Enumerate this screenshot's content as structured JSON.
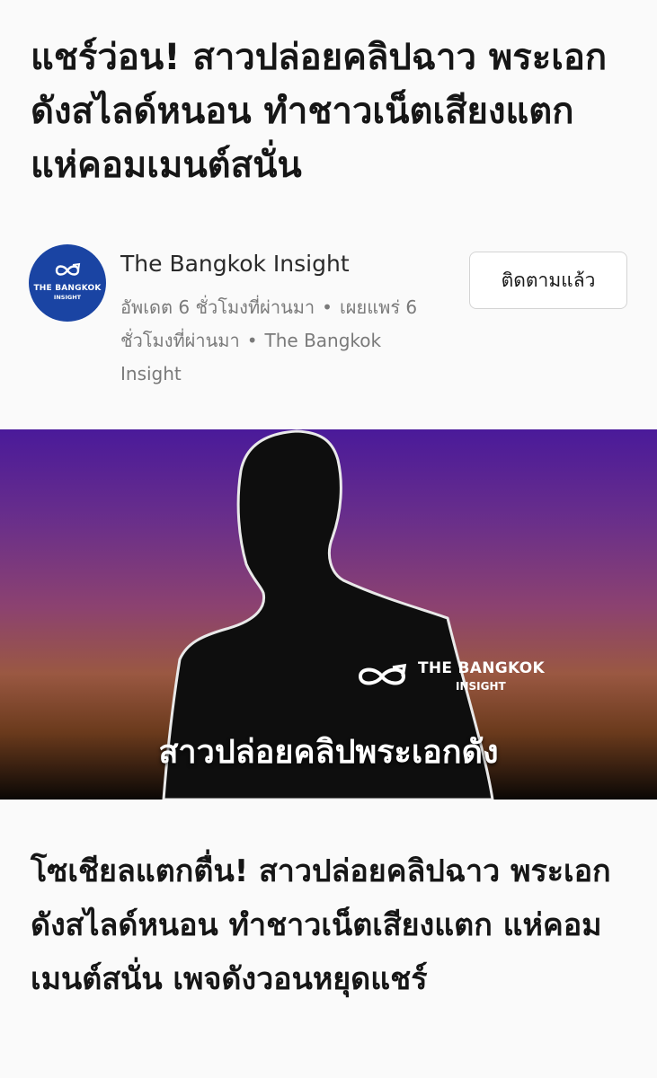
{
  "article": {
    "headline": "แชร์ว่อน! สาวปล่อยคลิปฉาว พระเอกดังสไลด์หนอน ทำชาวเน็ตเสียงแตก แห่คอมเมนต์สนั่น",
    "subheadline": "โซเชียลแตกตื่น! สาวปล่อยคลิปฉาว พระเอกดังสไลด์หนอน ทำชาวเน็ตเสียงแตก แห่คอมเมนต์สนั่น เพจดังวอนหยุดแชร์"
  },
  "publisher": {
    "name": "The Bangkok Insight",
    "logo_line1": "THE BANGKOK",
    "logo_line2": "INSIGHT",
    "logo_icon": "infinity-arrow-icon",
    "logo_color": "#1a44a3",
    "updated": "อัพเดต 6 ชั่วโมงที่ผ่านมา",
    "published": "เผยแพร่ 6 ชั่วโมงที่ผ่านมา",
    "source": "The Bangkok Insight",
    "follow_label": "ติดตามแล้ว"
  },
  "hero": {
    "caption": "สาวปล่อยคลิปพระเอกดัง",
    "brand_line1": "THE BANGKOK",
    "brand_line2": "INSIGHT",
    "brand_icon": "infinity-arrow-icon",
    "silhouette": "person-silhouette"
  }
}
